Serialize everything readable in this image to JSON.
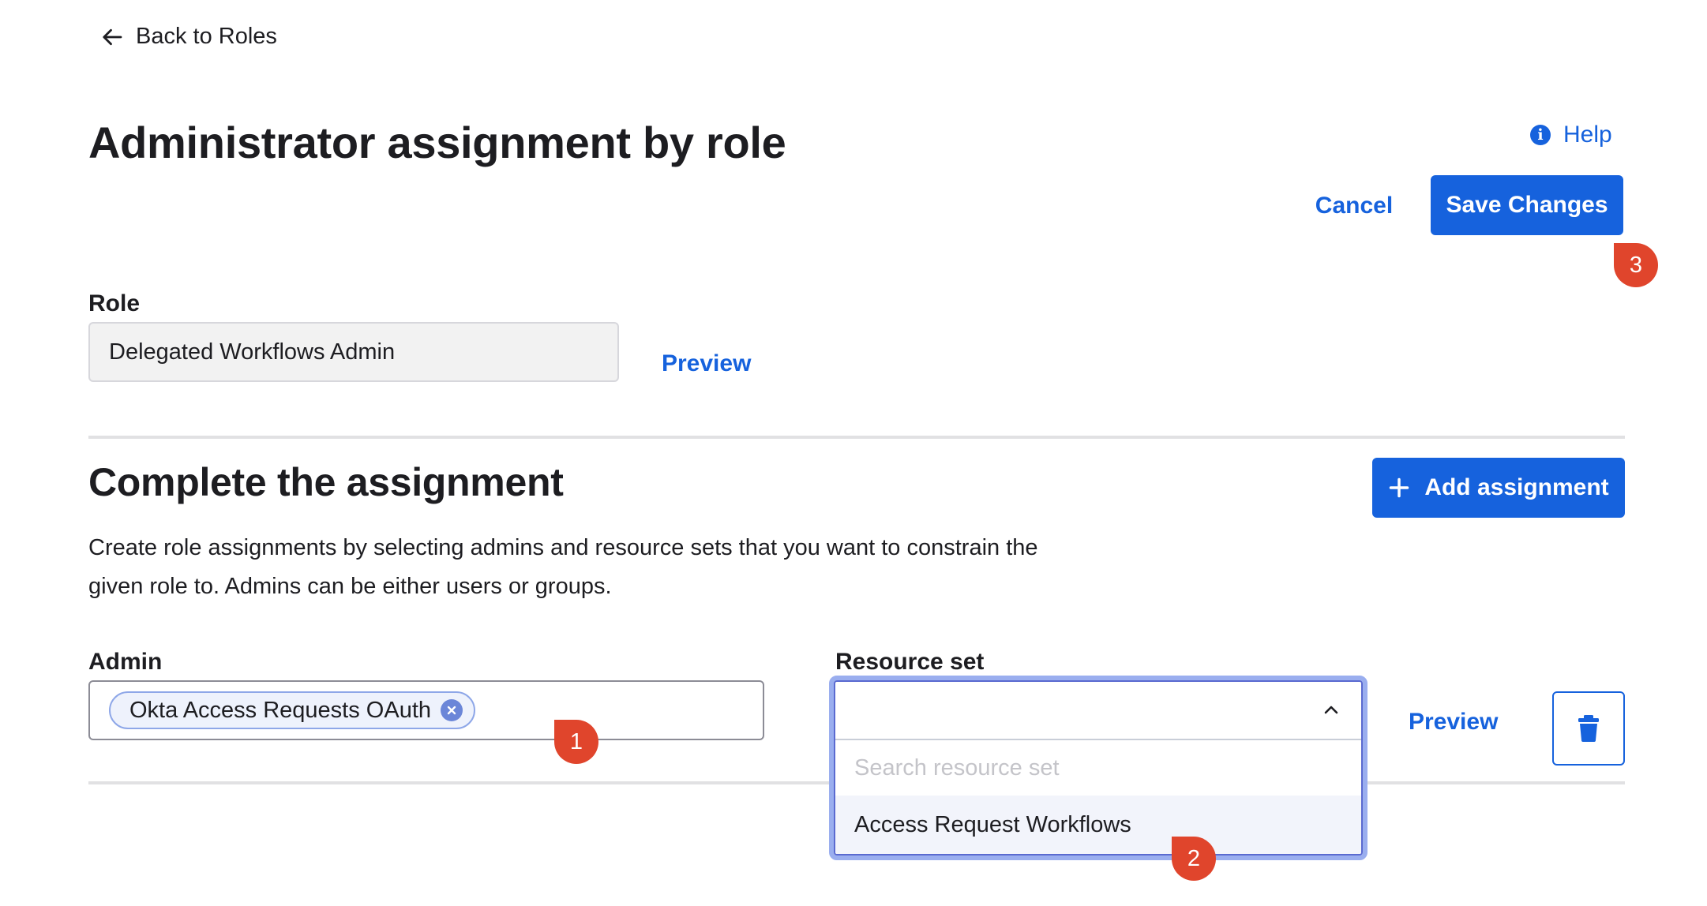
{
  "nav": {
    "back_label": "Back to Roles"
  },
  "header": {
    "title": "Administrator assignment by role",
    "help_label": "Help",
    "help_icon_glyph": "i",
    "cancel_label": "Cancel",
    "save_label": "Save Changes"
  },
  "role": {
    "label": "Role",
    "value": "Delegated Workflows Admin",
    "preview_label": "Preview"
  },
  "assignment": {
    "title": "Complete the assignment",
    "add_label": "Add assignment",
    "description": "Create role assignments by selecting admins and resource sets that you want to constrain the given role to. Admins can be either users or groups.",
    "admin_label": "Admin",
    "admin_chip": "Okta Access Requests OAuth",
    "resource_label": "Resource set",
    "resource_value": "",
    "search_placeholder": "Search resource set",
    "options": [
      "Access Request Workflows"
    ],
    "preview_label": "Preview"
  },
  "callouts": [
    "1",
    "2",
    "3"
  ],
  "icons": {
    "back": "arrow-left-icon",
    "help": "info-icon",
    "add": "plus-icon",
    "remove_chip": "close-circle-icon",
    "dropdown": "chevron-up-icon",
    "delete": "trash-icon"
  },
  "colors": {
    "primary": "#1662dd",
    "callout": "#e0452c",
    "text": "#1d1d21",
    "focus_ring": "#9aaeef"
  }
}
